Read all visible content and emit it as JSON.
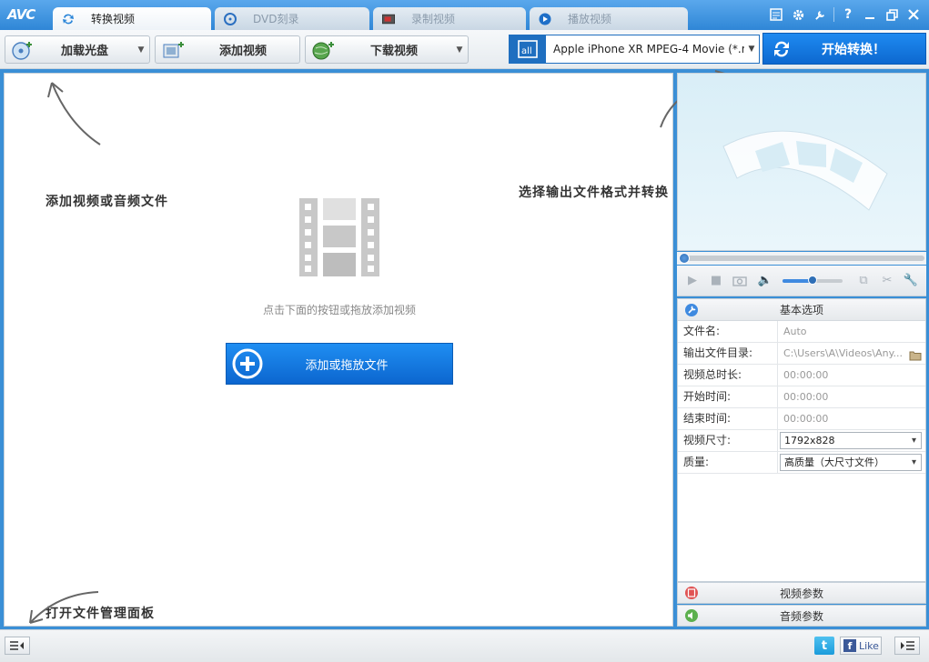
{
  "app": {
    "logo": "AVC"
  },
  "tabs": [
    {
      "label": "转换视频",
      "icon": "convert-icon",
      "active": true
    },
    {
      "label": "DVD刻录",
      "icon": "dvd-icon",
      "active": false
    },
    {
      "label": "录制视频",
      "icon": "record-icon",
      "active": false
    },
    {
      "label": "播放视频",
      "icon": "play-icon",
      "active": false
    }
  ],
  "window_controls": [
    "menu-icon",
    "gear-icon",
    "wrench-icon",
    "help-icon",
    "minimize-icon",
    "restore-icon",
    "close-icon"
  ],
  "help_label": "?",
  "toolbar": {
    "load_disc": "加载光盘",
    "add_video": "添加视频",
    "download_video": "下载视频"
  },
  "format": {
    "selected": "Apple iPhone XR MPEG-4 Movie (*.m..."
  },
  "convert_button": "开始转换！",
  "main": {
    "hint_add": "添加视频或音频文件",
    "hint_format": "选择输出文件格式并转换",
    "hint_panel": "打开文件管理面板",
    "drop_hint": "点击下面的按钮或拖放添加视频",
    "add_file_button": "添加或拖放文件"
  },
  "player": {
    "volume": 0.5,
    "seek": 0
  },
  "props": {
    "header": "基本选项",
    "rows": [
      {
        "key": "文件名:",
        "value": "Auto"
      },
      {
        "key": "输出文件目录:",
        "value": "C:\\Users\\A\\Videos\\Any..."
      },
      {
        "key": "视频总时长:",
        "value": "00:00:00"
      },
      {
        "key": "开始时间:",
        "value": "00:00:00"
      },
      {
        "key": "结束时间:",
        "value": "00:00:00"
      },
      {
        "key": "视频尺寸:",
        "value": "1792x828"
      },
      {
        "key": "质量:",
        "value": "高质量（大尺寸文件）"
      }
    ]
  },
  "video_params": "视频参数",
  "audio_params": "音频参数",
  "statusbar": {
    "like": "Like",
    "fb": "f",
    "tw": "t"
  },
  "colors": {
    "accent": "#1f6fc0",
    "titlebar": "#3a8fd6"
  }
}
